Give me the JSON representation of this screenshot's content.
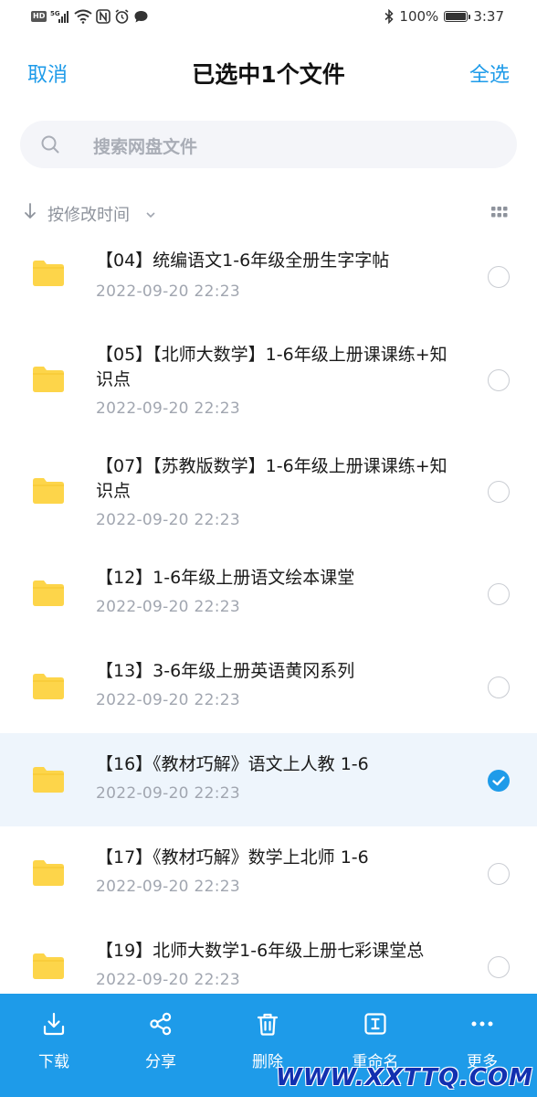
{
  "status_bar": {
    "left_icons": [
      "hd-icon",
      "signal-5g-icon",
      "wifi-icon",
      "nfc-icon",
      "alarm-icon",
      "message-icon"
    ],
    "hd_text": "HD",
    "network_text": "5G",
    "battery_percent": "100%",
    "battery_level": 1.0,
    "time": "3:37"
  },
  "header": {
    "cancel_label": "取消",
    "title": "已选中1个文件",
    "select_all_label": "全选"
  },
  "search": {
    "placeholder": "搜索网盘文件"
  },
  "sort": {
    "label": "按修改时间"
  },
  "files": [
    {
      "name": "【04】统编语文1-6年级全册生字字帖",
      "date": "2022-09-20  22:23",
      "selected": false
    },
    {
      "name": "【05】【北师大数学】1-6年级上册课课练+知识点",
      "date": "2022-09-20  22:23",
      "selected": false
    },
    {
      "name": "【07】【苏教版数学】1-6年级上册课课练+知识点",
      "date": "2022-09-20  22:23",
      "selected": false
    },
    {
      "name": "【12】1-6年级上册语文绘本课堂",
      "date": "2022-09-20  22:23",
      "selected": false
    },
    {
      "name": "【13】3-6年级上册英语黄冈系列",
      "date": "2022-09-20  22:23",
      "selected": false
    },
    {
      "name": "【16】《教材巧解》语文上人教 1-6",
      "date": "2022-09-20  22:23",
      "selected": true
    },
    {
      "name": "【17】《教材巧解》数学上北师 1-6",
      "date": "2022-09-20  22:23",
      "selected": false
    },
    {
      "name": "【19】北师大数学1-6年级上册七彩课堂总",
      "date": "2022-09-20  22:23",
      "selected": false
    }
  ],
  "toolbar": {
    "download_label": "下载",
    "share_label": "分享",
    "delete_label": "删除",
    "rename_label": "重命名",
    "more_label": "更多"
  },
  "watermark": "WWW.XXTTQ.COM",
  "colors": {
    "accent": "#1e9be9",
    "folder": "#fdd54a",
    "selected_row": "#eef5fc"
  }
}
